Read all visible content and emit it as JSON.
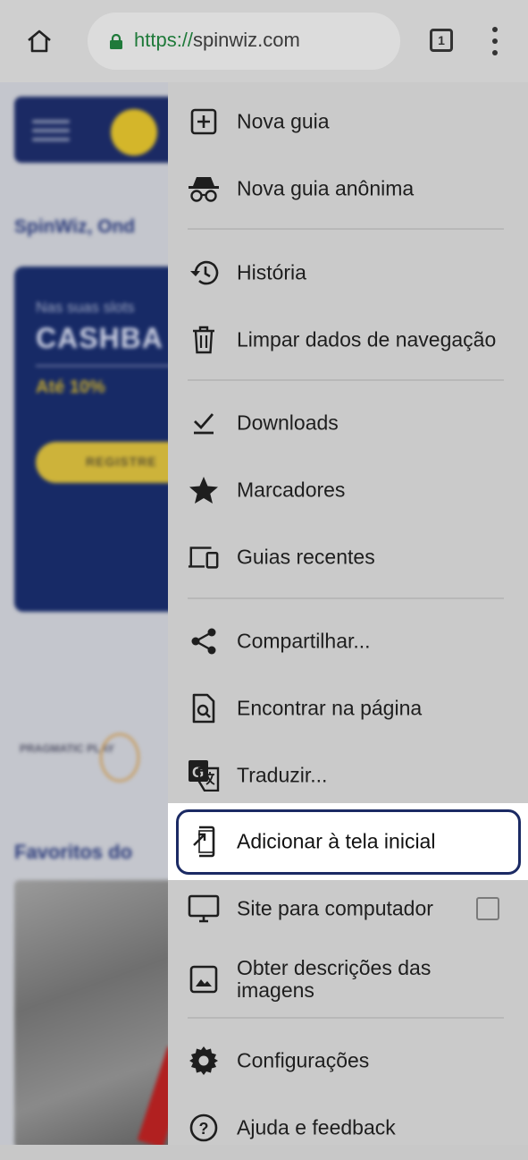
{
  "browser": {
    "url_scheme": "https://",
    "url_host": "spinwiz.com",
    "tab_count": "1",
    "icons": {
      "home": "home-icon",
      "lock": "lock-icon",
      "tabs": "tab-switcher-icon",
      "overflow": "more-vert-icon"
    },
    "colors": {
      "lock": "#1f7a3a",
      "toolbar": "#cfcfcf"
    }
  },
  "background_page": {
    "site_tagline": "SpinWiz, Ond",
    "promo_small": "Nas suas slots",
    "promo_big": "CASHBA",
    "promo_pct": "Até 10%",
    "promo_button": "REGISTRE",
    "provider_text": "PRAGMATIC PLAY",
    "favorites_title": "Favoritos do",
    "colors": {
      "navy": "#1b2a64",
      "gold": "#d4b62a"
    }
  },
  "menu": {
    "items": [
      {
        "label": "Nova guia",
        "icon": "new-tab-icon"
      },
      {
        "label": "Nova guia anônima",
        "icon": "incognito-icon"
      },
      {
        "label": "História",
        "icon": "history-icon"
      },
      {
        "label": "Limpar dados de navegação",
        "icon": "trash-icon"
      },
      {
        "label": "Downloads",
        "icon": "download-icon"
      },
      {
        "label": "Marcadores",
        "icon": "star-icon"
      },
      {
        "label": "Guias recentes",
        "icon": "devices-icon"
      },
      {
        "label": "Compartilhar...",
        "icon": "share-icon"
      },
      {
        "label": "Encontrar na página",
        "icon": "find-in-page-icon"
      },
      {
        "label": "Traduzir...",
        "icon": "translate-icon"
      },
      {
        "label": "Adicionar à tela inicial",
        "icon": "add-to-home-screen-icon",
        "highlighted": true
      },
      {
        "label": "Site para computador",
        "icon": "desktop-icon",
        "checkbox_checked": false
      },
      {
        "label": "Obter descrições das imagens",
        "icon": "image-description-icon"
      },
      {
        "label": "Configurações",
        "icon": "settings-gear-icon"
      },
      {
        "label": "Ajuda e feedback",
        "icon": "help-icon"
      }
    ],
    "highlight_color": "#1b2a64"
  }
}
